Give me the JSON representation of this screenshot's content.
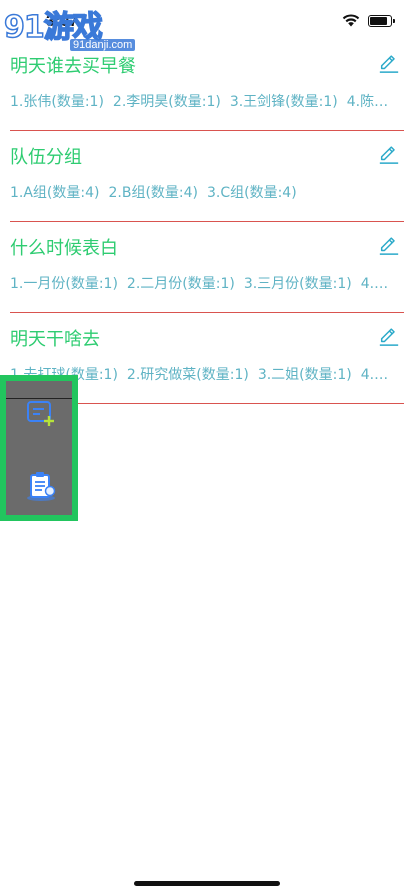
{
  "status": {
    "time": "3:07"
  },
  "watermark": {
    "main": "91游戏",
    "sub": "91danji.com"
  },
  "lists": [
    {
      "title": "明天谁去买早餐",
      "items": [
        "1.张伟(数量:1)",
        "2.李明昊(数量:1)",
        "3.王剑锋(数量:1)",
        "4.陈…"
      ]
    },
    {
      "title": "队伍分组",
      "items": [
        "1.A组(数量:4)",
        "2.B组(数量:4)",
        "3.C组(数量:4)"
      ]
    },
    {
      "title": "什么时候表白",
      "items": [
        "1.一月份(数量:1)",
        "2.二月份(数量:1)",
        "3.三月份(数量:1)",
        "4.…"
      ]
    },
    {
      "title": "明天干啥去",
      "items": [
        "1.去打球(数量:1)",
        "2.研究做菜(数量:1)",
        "3.二姐(数量:1)",
        "4.…"
      ]
    }
  ],
  "floating_panel": {
    "buttons": [
      {
        "icon": "add-list-icon"
      },
      {
        "icon": "clipboard-icon"
      }
    ]
  },
  "colors": {
    "title": "#2ecc71",
    "items": "#5fb3c4",
    "divider": "#d9534f",
    "panel_border": "#22c55e",
    "panel_bg": "#6b6b6b"
  }
}
